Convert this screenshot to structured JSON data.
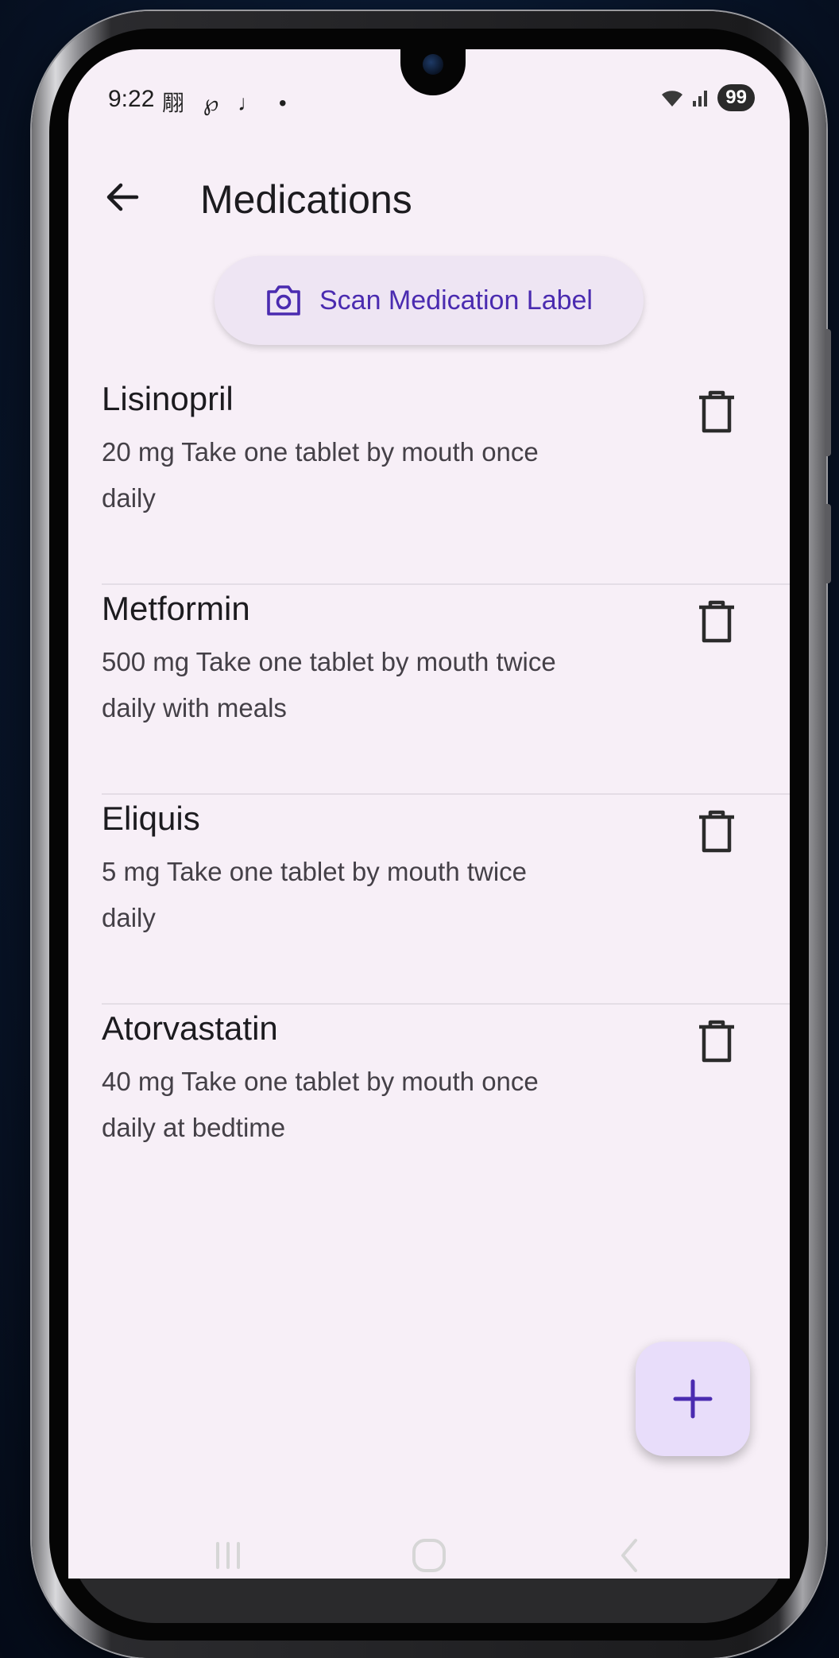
{
  "status": {
    "time": "9:22",
    "notification_icons": "翢 ℘ ♩ •",
    "battery": "99"
  },
  "header": {
    "title": "Medications"
  },
  "scan": {
    "label": "Scan Medication Label"
  },
  "medications": [
    {
      "name": "Lisinopril",
      "description": "20 mg Take one tablet by mouth once daily"
    },
    {
      "name": "Metformin",
      "description": "500 mg Take one tablet by mouth twice daily with meals"
    },
    {
      "name": "Eliquis",
      "description": "5 mg Take one tablet by mouth twice daily"
    },
    {
      "name": "Atorvastatin",
      "description": "40 mg Take one tablet by mouth once daily at bedtime"
    }
  ],
  "icons": {
    "back": "arrow-back-icon",
    "camera": "camera-icon",
    "delete": "trash-icon",
    "add": "plus-icon",
    "nav_recents": "recents-icon",
    "nav_home": "home-icon",
    "nav_back": "chevron-left-icon"
  },
  "colors": {
    "accent": "#4a2bb0",
    "screen_bg": "#f7eff7",
    "fab_bg": "#e8ddfa",
    "scan_bg": "#eee5f3"
  }
}
